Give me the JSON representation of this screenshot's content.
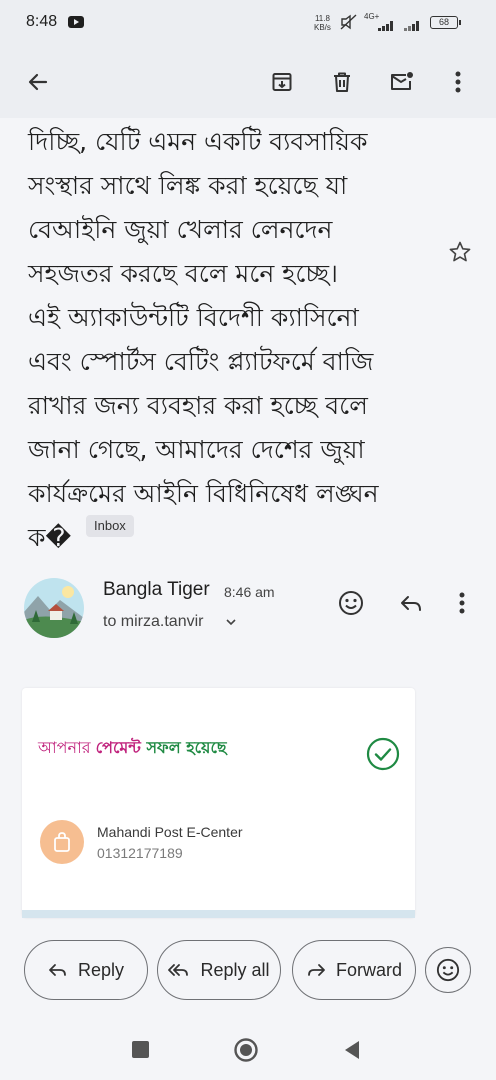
{
  "status_bar": {
    "time": "8:48",
    "net_speed_value": "11.8",
    "net_speed_unit": "KB/s",
    "network_label": "4G+",
    "battery": "68"
  },
  "toolbar": {
    "back_icon": "arrow-left-icon",
    "archive_icon": "archive-icon",
    "delete_icon": "trash-icon",
    "mark_unread_icon": "mail-unread-icon",
    "more_icon": "more-vert-icon"
  },
  "email": {
    "body": "দিচ্ছি, যেটি এমন একটি ব্যবসায়িক\nসংস্থার সাথে লিঙ্ক করা হয়েছে যা\nবেআইনি জুয়া খেলার লেনদেন\nসহজতর করছে বলে মনে হচ্ছে।\nএই অ্যাকাউন্টটি বিদেশী ক্যাসিনো\nএবং স্পোর্টস বেটিং প্ল্যাটফর্মে বাজি\nরাখার জন্য ব্যবহার করা হচ্ছে বলে\nজানা গেছে, আমাদের দেশের জুয়া\nকার্যক্রমের আইনি বিধিনিষেধ লঙ্ঘন\nক�",
    "label": "Inbox",
    "sender_name": "Bangla Tiger",
    "sent_time": "8:46 am",
    "recipient": "to mirza.tanvir"
  },
  "card": {
    "payment_part1": "আপনার ",
    "payment_part2": "পেমেন্ট ",
    "payment_part3": "সফল হয়েছে",
    "merchant_name": "Mahandi Post E-Center",
    "merchant_phone": "01312177189",
    "colors": {
      "pink": "#c0237d",
      "green": "#1f8a43",
      "logo_bg": "#f6be91"
    }
  },
  "actions": {
    "reply": "Reply",
    "reply_all": "Reply all",
    "forward": "Forward"
  }
}
